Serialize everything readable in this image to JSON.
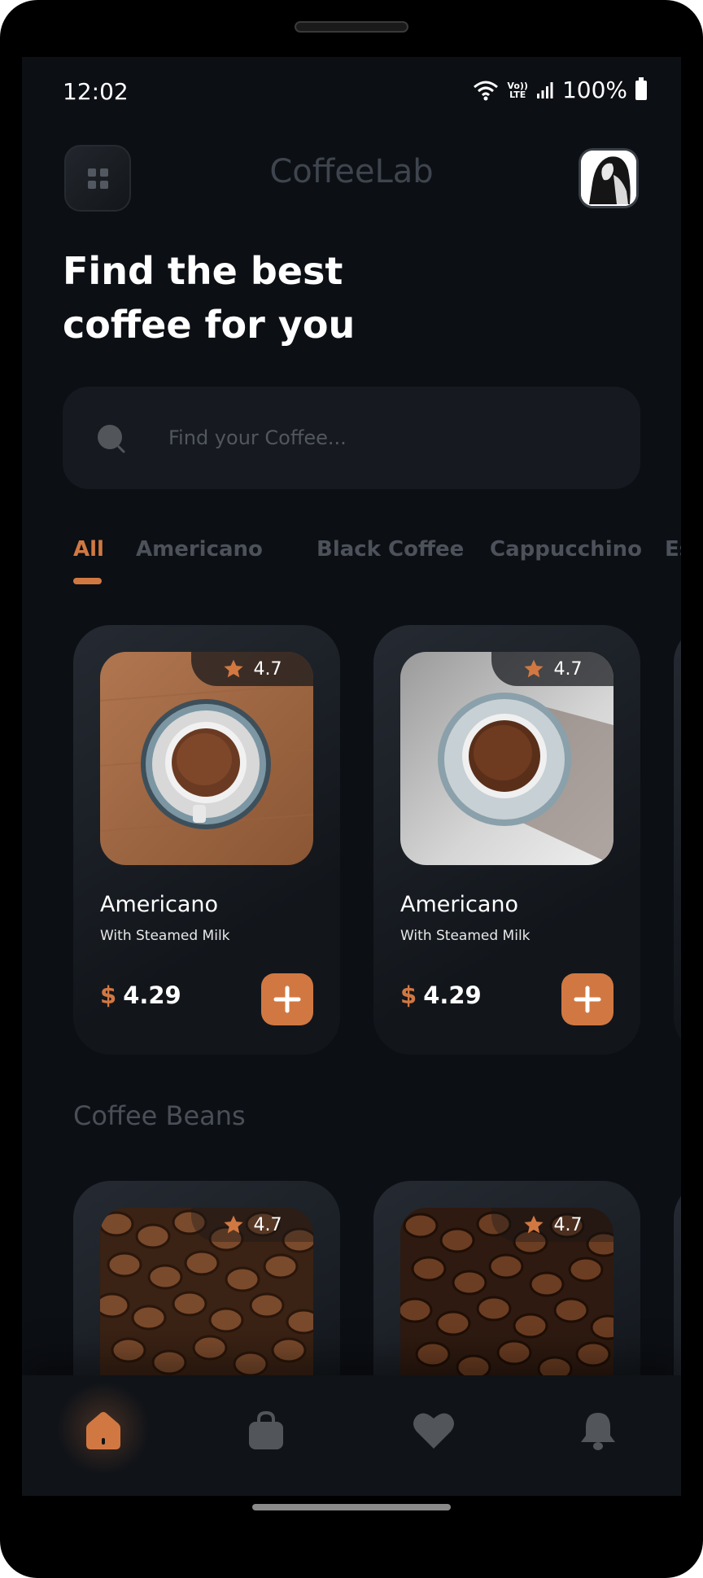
{
  "status": {
    "time": "12:02",
    "lte_top": "Vo))",
    "lte_bottom": "LTE",
    "battery": "100%"
  },
  "header": {
    "title": "CoffeeLab",
    "menu_icon": "grid-icon",
    "avatar_icon": "profile-avatar"
  },
  "headline": {
    "line1": "Find the best",
    "line2": "coffee for you"
  },
  "search": {
    "placeholder": "Find your Coffee..."
  },
  "tabs": {
    "items": [
      "All",
      "Americano",
      "Black Coffee",
      "Cappucchino",
      "Espresso"
    ],
    "active": "All"
  },
  "coffee_cards": [
    {
      "rating": "4.7",
      "name": "Americano",
      "subtitle": "With Steamed Milk",
      "currency": "$",
      "price": "4.29"
    },
    {
      "rating": "4.7",
      "name": "Americano",
      "subtitle": "With Steamed Milk",
      "currency": "$",
      "price": "4.29"
    }
  ],
  "beans": {
    "title": "Coffee Beans",
    "cards": [
      {
        "rating": "4.7"
      },
      {
        "rating": "4.7"
      }
    ]
  },
  "nav": {
    "items": [
      "home-icon",
      "bag-icon",
      "heart-icon",
      "bell-icon"
    ],
    "active": "home-icon"
  },
  "colors": {
    "accent": "#D17842",
    "background": "#0C0F14",
    "card": "#252A32",
    "muted": "#52555A"
  }
}
